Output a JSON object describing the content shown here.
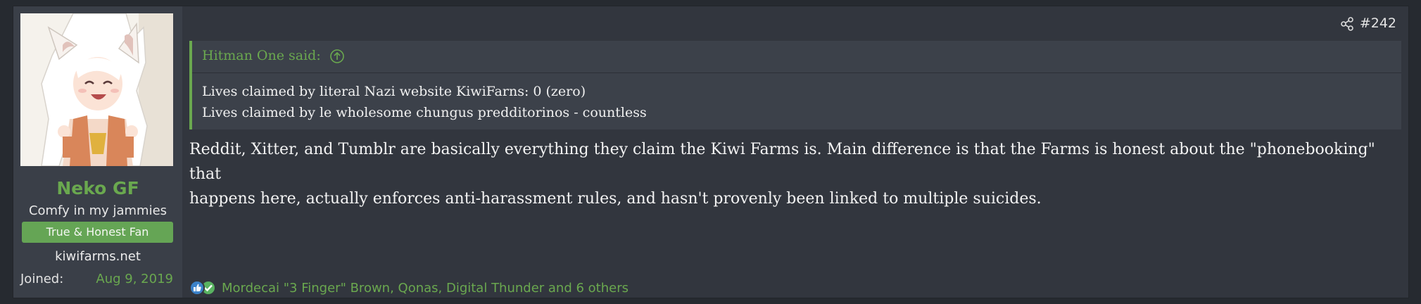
{
  "user": {
    "name": "Neko GF",
    "title": "Comfy in my jammies",
    "banner": "True & Honest Fan",
    "site": "kiwifarms.net",
    "joined_label": "Joined:",
    "joined_date": "Aug 9, 2019",
    "avatar": "anime-catgirl-avatar"
  },
  "post": {
    "number": "#242",
    "share_icon": "share-icon",
    "quote": {
      "author": "Hitman One said:",
      "lines": [
        "Lives claimed by literal Nazi website KiwiFarns: 0 (zero)",
        "Lives claimed by le wholesome chungus predditorinos - countless"
      ]
    },
    "body_lines": [
      "Reddit, Xitter, and Tumblr are basically everything they claim the Kiwi Farms is. Main difference is that the Farms is honest about the \"phonebooking\" that",
      "happens here, actually enforces anti-harassment rules, and hasn't provenly been linked to multiple suicides."
    ],
    "reactions": {
      "icons": [
        "like-icon",
        "agree-icon"
      ],
      "text": "Mordecai \"3 Finger\" Brown, Qonas, Digital Thunder and 6 others"
    }
  },
  "colors": {
    "accent": "#6aa84f",
    "banner": "#65a555",
    "panel": "#32363e",
    "sidebar": "#3a3f48",
    "quote_bg": "#3c414a"
  }
}
